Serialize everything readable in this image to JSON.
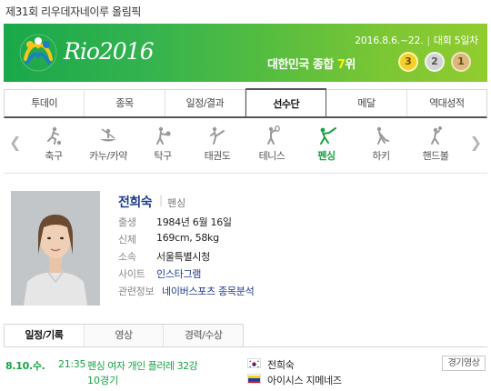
{
  "page": {
    "title": "제31회 리우데자네이루 올림픽"
  },
  "banner": {
    "logo_text": "Rio2016",
    "dates": "2016.8.6.~22.",
    "day_label": "대회 5일차",
    "rank_prefix": "대한민국 종합 ",
    "rank_number": "7",
    "rank_suffix": "위",
    "medals": {
      "gold": "3",
      "silver": "2",
      "bronze": "1"
    },
    "colors": {
      "gold": "#f2d028",
      "silver": "#d4d4d4",
      "bronze": "#d9b87a"
    }
  },
  "main_nav": {
    "tabs": [
      {
        "label": "투데이"
      },
      {
        "label": "종목"
      },
      {
        "label": "일정/결과"
      },
      {
        "label": "선수단",
        "active": true
      },
      {
        "label": "메달"
      },
      {
        "label": "역대성적"
      }
    ]
  },
  "sport_nav": {
    "prev_icon": "chevron-left-icon",
    "next_icon": "chevron-right-icon",
    "items": [
      {
        "label": "축구",
        "icon": "football-icon"
      },
      {
        "label": "카누/카약",
        "icon": "canoe-icon"
      },
      {
        "label": "탁구",
        "icon": "table-tennis-icon"
      },
      {
        "label": "태권도",
        "icon": "taekwondo-icon"
      },
      {
        "label": "테니스",
        "icon": "tennis-icon"
      },
      {
        "label": "펜싱",
        "icon": "fencing-icon",
        "active": true
      },
      {
        "label": "하키",
        "icon": "hockey-icon"
      },
      {
        "label": "핸드볼",
        "icon": "handball-icon"
      }
    ]
  },
  "athlete": {
    "name": "전희숙",
    "sport": "펜싱",
    "rows": [
      {
        "key": "출생",
        "value": "1984년 6월 16일"
      },
      {
        "key": "신체",
        "value": "169cm, 58kg"
      },
      {
        "key": "소속",
        "value": "서울특별시청"
      },
      {
        "key": "사이트",
        "value": "인스타그램"
      },
      {
        "key": "관련정보",
        "value": "네이버스포츠 종목분석"
      }
    ]
  },
  "sub_nav": {
    "tabs": [
      {
        "label": "일정/기록",
        "active": true
      },
      {
        "label": "영상"
      },
      {
        "label": "경력/수상"
      }
    ]
  },
  "schedule": {
    "date": "8.10.수.",
    "time": "21:35",
    "event": "펜싱 여자 개인 플러레 32강",
    "round": "10경기",
    "players": [
      {
        "name": "전희숙",
        "flag": "flag-korea-icon"
      },
      {
        "name": "아이시스 지메네즈",
        "flag": "flag-venezuela-icon"
      }
    ],
    "video_button": "경기영상"
  },
  "colors": {
    "accent_green": "#19a346",
    "link_blue": "#1f3c8c"
  }
}
